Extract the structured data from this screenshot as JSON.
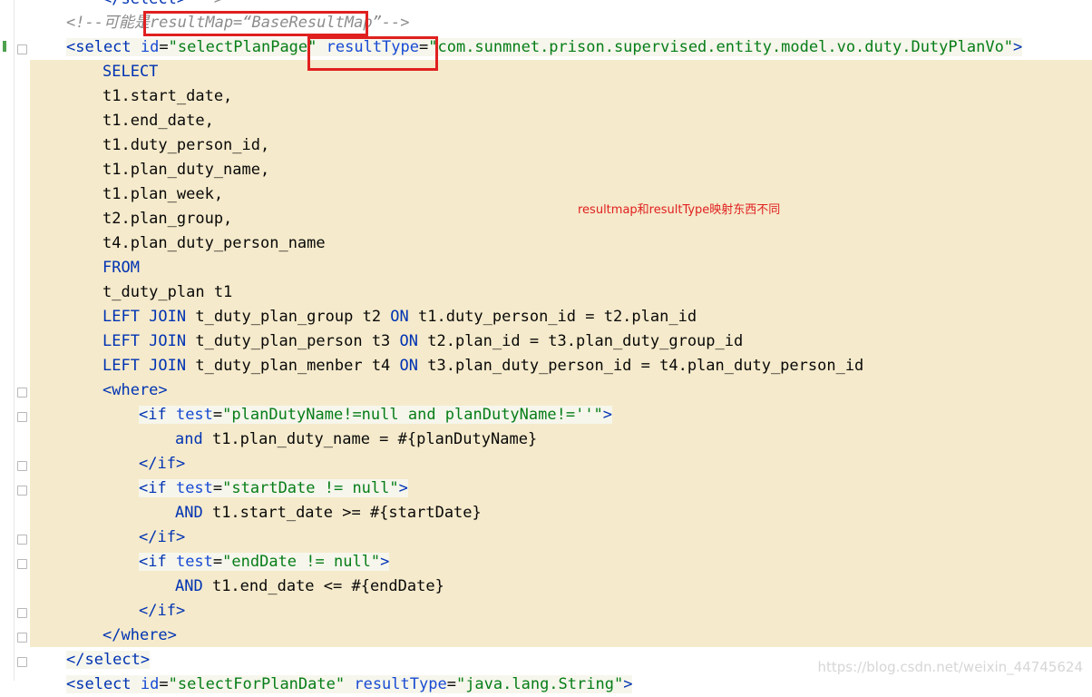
{
  "editor": {
    "lines": [
      {
        "segs": [
          {
            "c": "tag",
            "t": "</select>"
          },
          {
            "c": "cmt",
            "t": " -->"
          }
        ]
      },
      {
        "segs": [
          {
            "c": "cmt",
            "t": "<!--可能是resultMap=“BaseResultMap”-->"
          }
        ]
      },
      {
        "segs": [
          {
            "c": "tag",
            "t": "<select "
          },
          {
            "c": "attr",
            "t": "id"
          },
          {
            "c": "plain",
            "t": "="
          },
          {
            "c": "str",
            "t": "\"selectPlanPage\""
          },
          {
            "c": "plain",
            "t": " "
          },
          {
            "c": "attr",
            "t": "resultType"
          },
          {
            "c": "plain",
            "t": "="
          },
          {
            "c": "str",
            "t": "\"com.sunmnet.prison.supervised.entity.model.vo.duty.DutyPlanVo\""
          },
          {
            "c": "tag",
            "t": ">"
          }
        ]
      },
      {
        "segs": [
          {
            "c": "kw",
            "t": "SELECT"
          }
        ]
      },
      {
        "segs": [
          {
            "c": "plain",
            "t": "t1.start_date,"
          }
        ]
      },
      {
        "segs": [
          {
            "c": "plain",
            "t": "t1.end_date,"
          }
        ]
      },
      {
        "segs": [
          {
            "c": "plain",
            "t": "t1.duty_person_id,"
          }
        ]
      },
      {
        "segs": [
          {
            "c": "plain",
            "t": "t1.plan_duty_name,"
          }
        ]
      },
      {
        "segs": [
          {
            "c": "plain",
            "t": "t1.plan_week,"
          }
        ]
      },
      {
        "segs": [
          {
            "c": "plain",
            "t": "t2.plan_group,"
          }
        ]
      },
      {
        "segs": [
          {
            "c": "plain",
            "t": "t4.plan_duty_person_name"
          }
        ]
      },
      {
        "segs": [
          {
            "c": "kw",
            "t": "FROM"
          }
        ]
      },
      {
        "segs": [
          {
            "c": "plain",
            "t": "t_duty_plan t1"
          }
        ]
      },
      {
        "segs": [
          {
            "c": "kw",
            "t": "LEFT JOIN"
          },
          {
            "c": "plain",
            "t": " t_duty_plan_group t2 "
          },
          {
            "c": "kw",
            "t": "ON"
          },
          {
            "c": "plain",
            "t": " t1.duty_person_id = t2.plan_id"
          }
        ]
      },
      {
        "segs": [
          {
            "c": "kw",
            "t": "LEFT JOIN"
          },
          {
            "c": "plain",
            "t": " t_duty_plan_person t3 "
          },
          {
            "c": "kw",
            "t": "ON"
          },
          {
            "c": "plain",
            "t": " t2.plan_id = t3.plan_duty_group_id"
          }
        ]
      },
      {
        "segs": [
          {
            "c": "kw",
            "t": "LEFT JOIN"
          },
          {
            "c": "plain",
            "t": " t_duty_plan_menber t4 "
          },
          {
            "c": "kw",
            "t": "ON"
          },
          {
            "c": "plain",
            "t": " t3.plan_duty_person_id = t4.plan_duty_person_id"
          }
        ]
      },
      {
        "segs": [
          {
            "c": "tag",
            "t": "<where>"
          }
        ]
      },
      {
        "segs": [
          {
            "c": "tag",
            "t": "<if "
          },
          {
            "c": "attr",
            "t": "test"
          },
          {
            "c": "plain",
            "t": "="
          },
          {
            "c": "str",
            "t": "\"planDutyName!=null and planDutyName!=''\""
          },
          {
            "c": "tag",
            "t": ">"
          }
        ]
      },
      {
        "segs": [
          {
            "c": "kw",
            "t": "and"
          },
          {
            "c": "plain",
            "t": " t1.plan_duty_name = #{planDutyName}"
          }
        ]
      },
      {
        "segs": [
          {
            "c": "tag",
            "t": "</if>"
          }
        ]
      },
      {
        "segs": [
          {
            "c": "tag",
            "t": "<if "
          },
          {
            "c": "attr",
            "t": "test"
          },
          {
            "c": "plain",
            "t": "="
          },
          {
            "c": "str",
            "t": "\"startDate != null\""
          },
          {
            "c": "tag",
            "t": ">"
          }
        ]
      },
      {
        "segs": [
          {
            "c": "kw",
            "t": "AND"
          },
          {
            "c": "plain",
            "t": " t1.start_date >= #{startDate}"
          }
        ]
      },
      {
        "segs": [
          {
            "c": "tag",
            "t": "</if>"
          }
        ]
      },
      {
        "segs": [
          {
            "c": "tag",
            "t": "<if "
          },
          {
            "c": "attr",
            "t": "test"
          },
          {
            "c": "plain",
            "t": "="
          },
          {
            "c": "str",
            "t": "\"endDate != null\""
          },
          {
            "c": "tag",
            "t": ">"
          }
        ]
      },
      {
        "segs": [
          {
            "c": "kw",
            "t": "AND"
          },
          {
            "c": "plain",
            "t": " t1.end_date <= #{endDate}"
          }
        ]
      },
      {
        "segs": [
          {
            "c": "tag",
            "t": "</if>"
          }
        ]
      },
      {
        "segs": [
          {
            "c": "tag",
            "t": "</where>"
          }
        ]
      },
      {
        "segs": [
          {
            "c": "tag",
            "t": "</select>"
          }
        ]
      },
      {
        "segs": [
          {
            "c": "tag",
            "t": "<select "
          },
          {
            "c": "attr",
            "t": "id"
          },
          {
            "c": "plain",
            "t": "="
          },
          {
            "c": "str",
            "t": "\"selectForPlanDate\""
          },
          {
            "c": "plain",
            "t": " "
          },
          {
            "c": "attr",
            "t": "resultType"
          },
          {
            "c": "plain",
            "t": "="
          },
          {
            "c": "str",
            "t": "\"java.lang.String\""
          },
          {
            "c": "tag",
            "t": ">"
          }
        ]
      }
    ]
  },
  "annotation": {
    "text": "resultmap和resultType映射东西不同"
  },
  "watermark": {
    "text": "https://blog.csdn.net/weixin_44745624"
  },
  "colors": {
    "tag": "#0033b3",
    "string": "#067d17",
    "comment": "#8c8c8c",
    "highlight": "#f5eacb",
    "annotation": "#e02020"
  }
}
